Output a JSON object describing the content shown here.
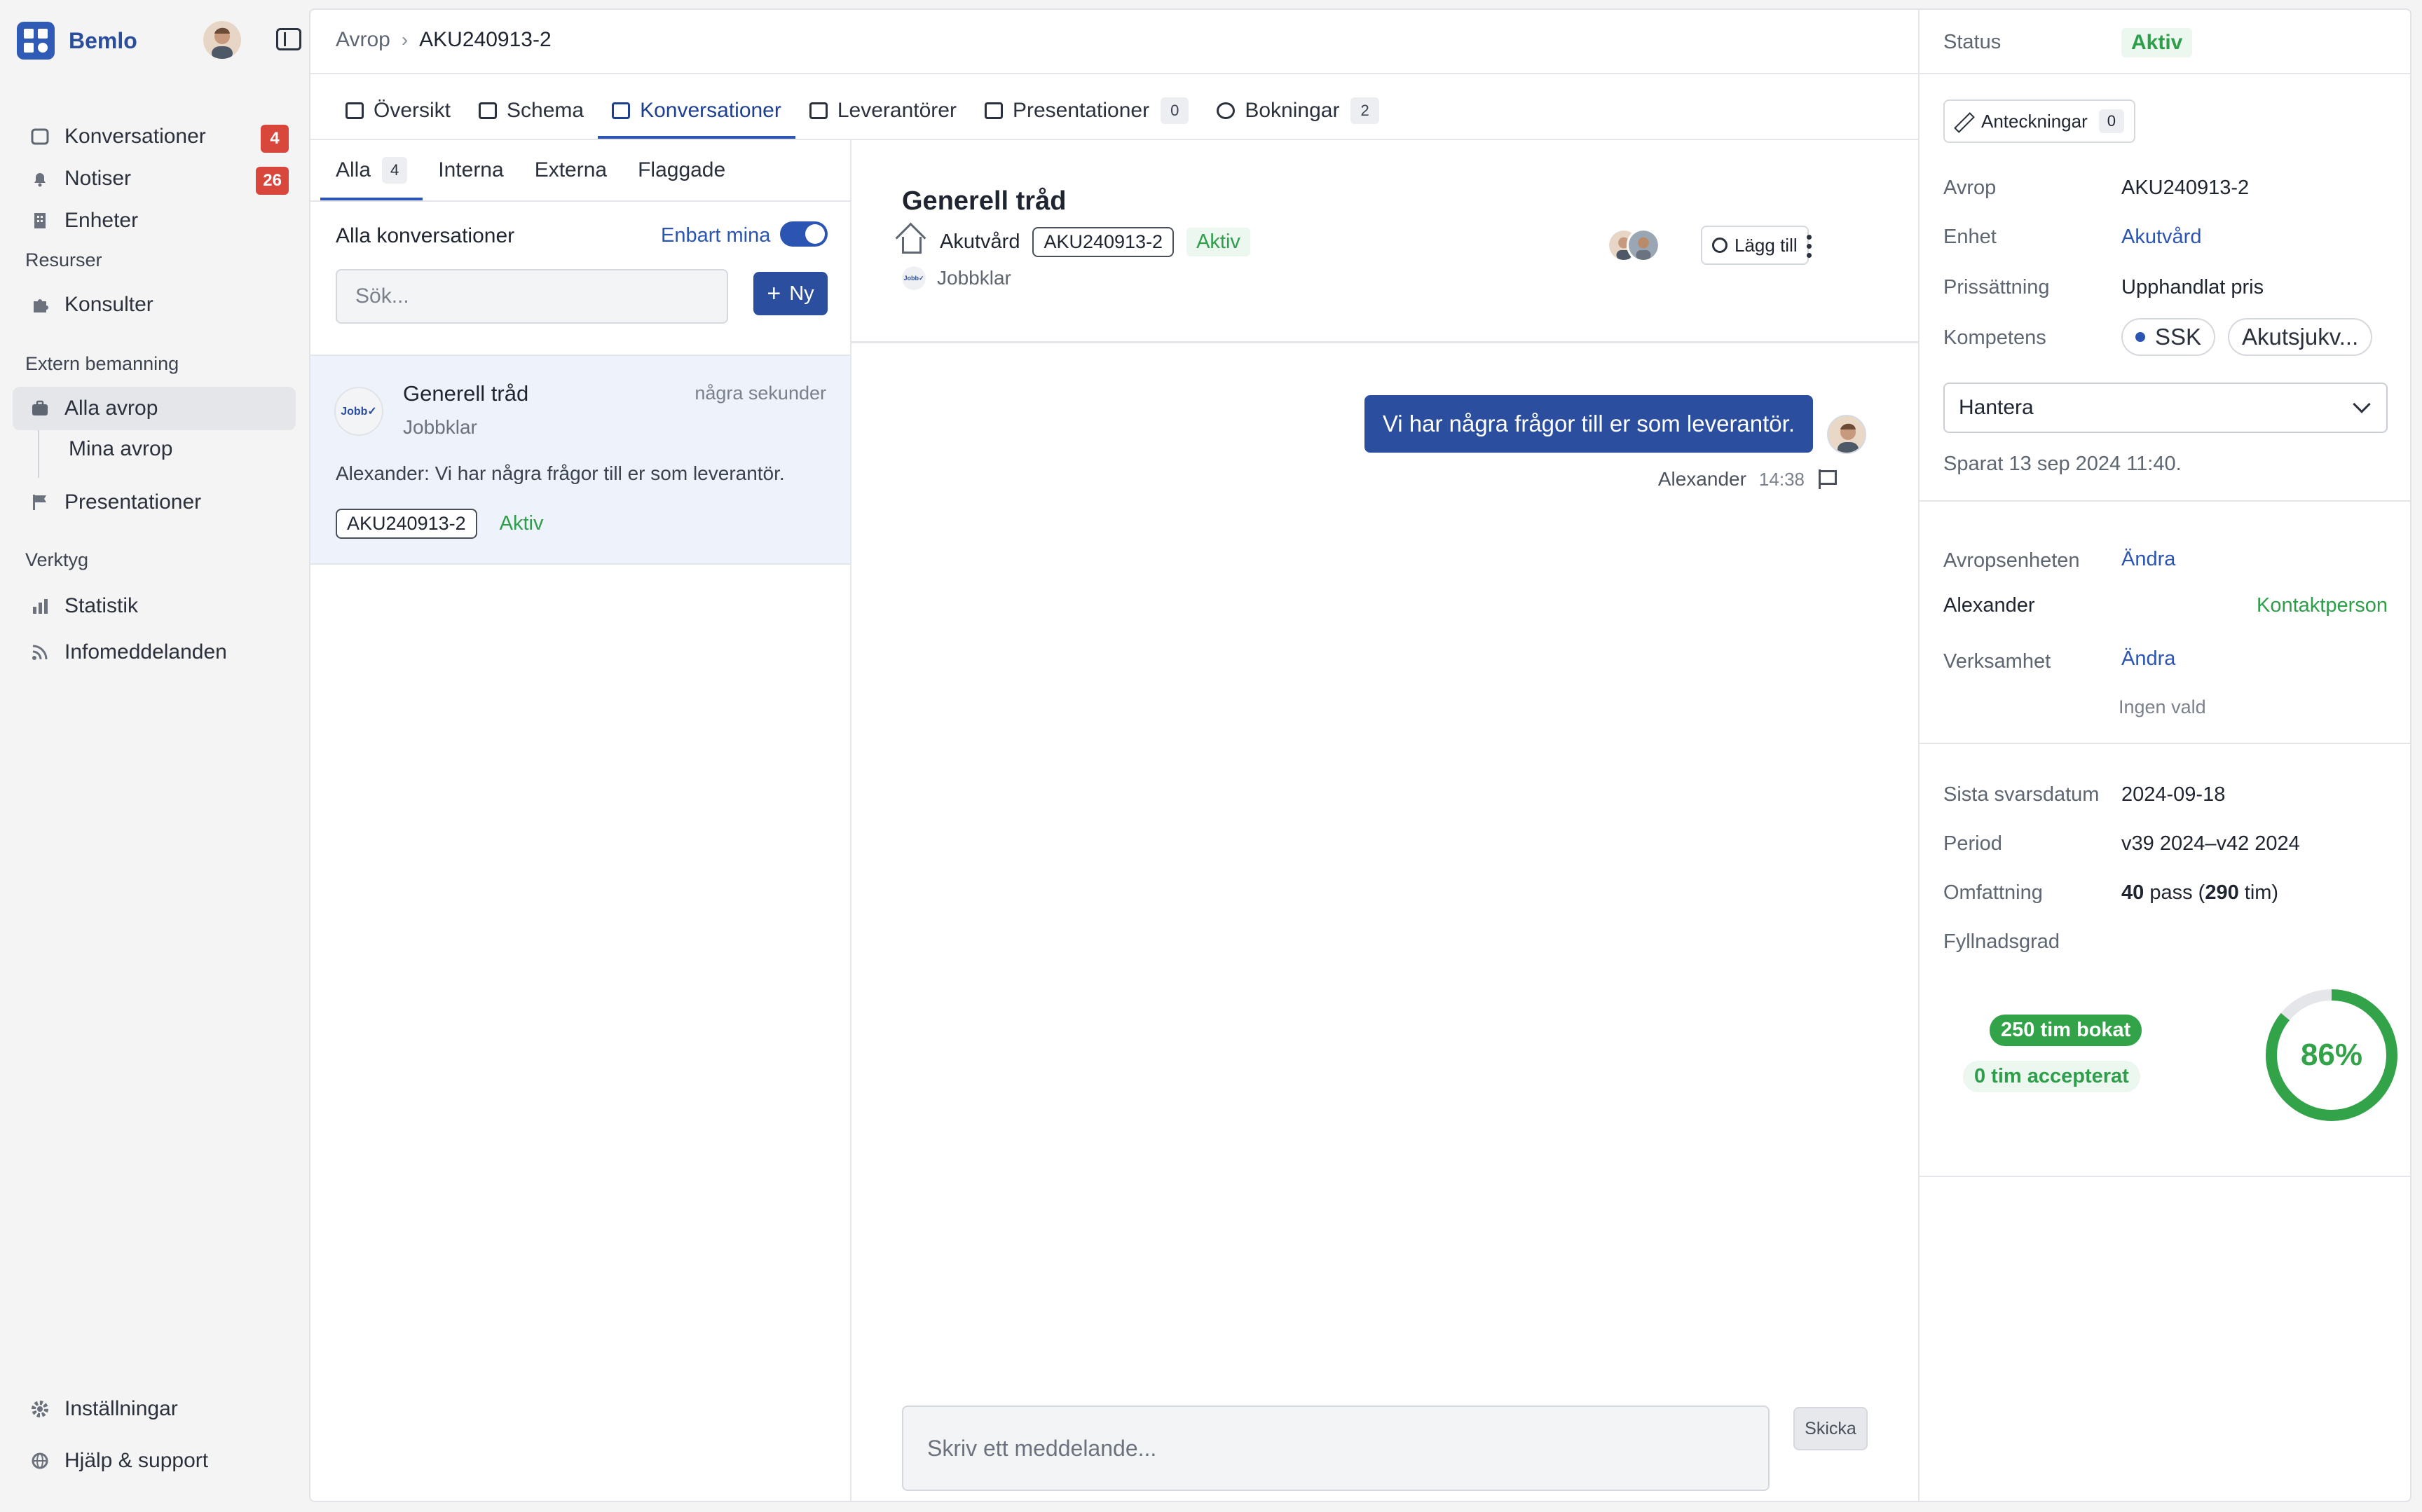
{
  "sidebar": {
    "brand": "Bemlo",
    "items": [
      {
        "label": "Konversationer",
        "badge": "4"
      },
      {
        "label": "Notiser",
        "badge": "26"
      },
      {
        "label": "Enheter"
      }
    ],
    "sections": {
      "resources": "Resurser",
      "external": "Extern bemanning",
      "tools": "Verktyg"
    },
    "resources": [
      {
        "label": "Konsulter"
      }
    ],
    "external": [
      {
        "label": "Alla avrop"
      },
      {
        "label": "Mina avrop"
      },
      {
        "label": "Presentationer"
      }
    ],
    "tools": [
      {
        "label": "Statistik"
      },
      {
        "label": "Infomeddelanden"
      }
    ],
    "bottom": [
      {
        "label": "Inställningar"
      },
      {
        "label": "Hjälp & support"
      }
    ]
  },
  "breadcrumb": {
    "parent": "Avrop",
    "current": "AKU240913-2"
  },
  "tabs": [
    {
      "label": "Översikt"
    },
    {
      "label": "Schema"
    },
    {
      "label": "Konversationer"
    },
    {
      "label": "Leverantörer"
    },
    {
      "label": "Presentationer",
      "count": "0"
    },
    {
      "label": "Bokningar",
      "count": "2"
    }
  ],
  "list": {
    "subtabs": [
      {
        "label": "Alla",
        "count": "4"
      },
      {
        "label": "Interna"
      },
      {
        "label": "Externa"
      },
      {
        "label": "Flaggade"
      }
    ],
    "heading": "Alla konversationer",
    "only_mine": "Enbart mina",
    "search_placeholder": "Sök...",
    "new_label": "Ny",
    "item": {
      "avatar_text": "Jobb✓",
      "title": "Generell tråd",
      "time": "några sekunder",
      "subtitle": "Jobbklar",
      "preview": "Alexander: Vi har några frågor till er som leverantör.",
      "tag": "AKU240913-2",
      "status": "Aktiv"
    }
  },
  "chat": {
    "title": "Generell tråd",
    "unit": "Akutvård",
    "tag": "AKU240913-2",
    "status": "Aktiv",
    "org_logo": "Jobb✓",
    "org": "Jobbklar",
    "add_label": "Lägg till",
    "message": {
      "text": "Vi har några frågor till er som leverantör.",
      "author": "Alexander",
      "time": "14:38"
    },
    "composer_placeholder": "Skriv ett meddelande...",
    "send_label": "Skicka"
  },
  "panel": {
    "status_label": "Status",
    "status_value": "Aktiv",
    "notes_label": "Anteckningar",
    "notes_count": "0",
    "fields": [
      {
        "label": "Avrop",
        "value": "AKU240913-2"
      },
      {
        "label": "Enhet",
        "value": "Akutvård"
      },
      {
        "label": "Prissättning",
        "value": "Upphandlat pris"
      },
      {
        "label": "Kompetens"
      }
    ],
    "competence_chips": [
      "SSK",
      "Akutsjukv..."
    ],
    "handle_label": "Hantera",
    "saved": "Sparat 13 sep 2024 11:40.",
    "unit_label": "Avropsenheten",
    "change_label": "Ändra",
    "contact_name": "Alexander",
    "contact_role": "Kontaktperson",
    "business_label": "Verksamhet",
    "business_change": "Ändra",
    "business_value": "Ingen vald",
    "deadline_label": "Sista svarsdatum",
    "deadline": "2024-09-18",
    "period_label": "Period",
    "period": "v39 2024–v42 2024",
    "scope_label": "Omfattning",
    "scope_pass": "40",
    "scope_pass_unit": "pass (",
    "scope_hours": "290",
    "scope_hours_unit": "tim)",
    "fill_label": "Fyllnadsgrad",
    "booked": "250 tim bokat",
    "accepted": "0 tim accepterat",
    "fill_percent": "86%",
    "fill_fraction": 0.86
  },
  "colors": {
    "primary": "#2b4f9e",
    "accent": "#2b54b3",
    "success": "#33a349",
    "danger": "#d8463c"
  }
}
